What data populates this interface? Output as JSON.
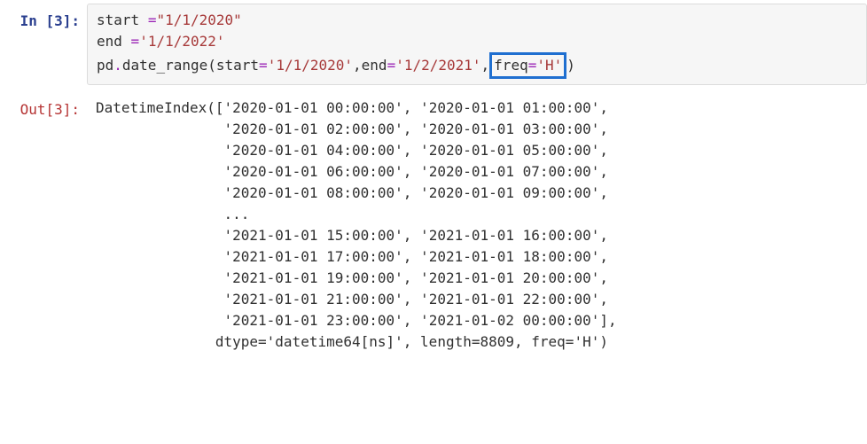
{
  "cell": {
    "in_prompt_prefix": "In [",
    "in_prompt_num": "3",
    "in_prompt_suffix": "]:",
    "out_prompt_prefix": "Out[",
    "out_prompt_num": "3",
    "out_prompt_suffix": "]:"
  },
  "code": {
    "line1": {
      "var": "start",
      "op": "=",
      "str": "\"1/1/2020\""
    },
    "line2": {
      "var": "end",
      "op": "=",
      "str": "'1/1/2022'"
    },
    "line3": {
      "obj": "pd",
      "dot": ".",
      "func": "date_range",
      "open": "(",
      "p1name": "start",
      "eq": "=",
      "p1val": "'1/1/2020'",
      "comma": ",",
      "p2name": "end",
      "p2val": "'1/2/2021'",
      "p3name": "freq",
      "p3val": "'H'",
      "close": ")"
    }
  },
  "output": {
    "head": "DatetimeIndex([",
    "rows": [
      "'2020-01-01 00:00:00', '2020-01-01 01:00:00',",
      "'2020-01-01 02:00:00', '2020-01-01 03:00:00',",
      "'2020-01-01 04:00:00', '2020-01-01 05:00:00',",
      "'2020-01-01 06:00:00', '2020-01-01 07:00:00',",
      "'2020-01-01 08:00:00', '2020-01-01 09:00:00',",
      "...",
      "'2021-01-01 15:00:00', '2021-01-01 16:00:00',",
      "'2021-01-01 17:00:00', '2021-01-01 18:00:00',",
      "'2021-01-01 19:00:00', '2021-01-01 20:00:00',",
      "'2021-01-01 21:00:00', '2021-01-01 22:00:00',",
      "'2021-01-01 23:00:00', '2021-01-02 00:00:00'],"
    ],
    "tail": "dtype='datetime64[ns]', length=8809, freq='H')"
  }
}
